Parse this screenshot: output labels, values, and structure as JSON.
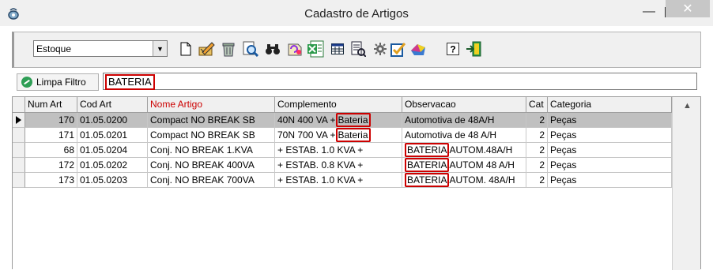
{
  "window": {
    "title": "Cadastro de Artigos",
    "minimize": "—",
    "close": "✕"
  },
  "toolbar": {
    "combo_value": "Estoque",
    "icons": [
      "new-document-icon",
      "edit-icon",
      "delete-icon",
      "search-icon",
      "binoculars-icon",
      "refresh-icon",
      "excel-icon",
      "grid-icon",
      "report-icon",
      "settings-icon",
      "check-icon",
      "chart-icon",
      "help-icon",
      "exit-icon"
    ]
  },
  "filter": {
    "clear_label": "Limpa Filtro",
    "value": "BATERIA"
  },
  "grid": {
    "columns": [
      "Num Art",
      "Cod Art",
      "Nome Artigo",
      "Complemento",
      "Observacao",
      "Cat",
      "Categoria"
    ],
    "rows": [
      {
        "num": "170",
        "cod": "01.05.0200",
        "nome": "Compact NO BREAK SB",
        "comp_pre": "40N 400 VA +",
        "comp_hl": "Bateria",
        "obs_hl": "",
        "obs_post": "Automotiva de 48A/H",
        "cat": "2",
        "categoria": "Peças"
      },
      {
        "num": "171",
        "cod": "01.05.0201",
        "nome": "Compact NO BREAK SB",
        "comp_pre": "70N 700 VA +",
        "comp_hl": "Bateria",
        "obs_hl": "",
        "obs_post": "Automotiva de 48 A/H",
        "cat": "2",
        "categoria": "Peças"
      },
      {
        "num": "68",
        "cod": "01.05.0204",
        "nome": "Conj. NO BREAK 1.KVA",
        "comp_pre": "+ ESTAB. 1.0 KVA +",
        "comp_hl": "",
        "obs_hl": "BATERIA",
        "obs_post": "AUTOM.48A/H",
        "cat": "2",
        "categoria": "Peças"
      },
      {
        "num": "172",
        "cod": "01.05.0202",
        "nome": "Conj. NO BREAK 400VA",
        "comp_pre": "+ ESTAB. 0.8 KVA +",
        "comp_hl": "",
        "obs_hl": "BATERIA",
        "obs_post": "AUTOM 48 A/H",
        "cat": "2",
        "categoria": "Peças"
      },
      {
        "num": "173",
        "cod": "01.05.0203",
        "nome": "Conj. NO BREAK 700VA",
        "comp_pre": "+ ESTAB. 1.0 KVA +",
        "comp_hl": "",
        "obs_hl": "BATERIA",
        "obs_post": "AUTOM. 48A/H",
        "cat": "2",
        "categoria": "Peças"
      }
    ]
  },
  "colors": {
    "sorted_header": "#cc0000",
    "highlight_box": "#cc0000",
    "selected_row": "#c0c0c0"
  }
}
